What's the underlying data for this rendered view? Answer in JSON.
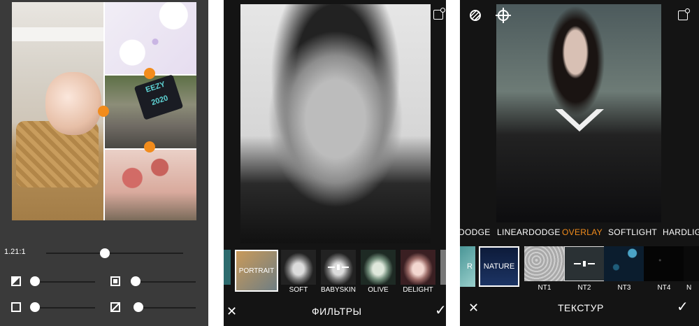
{
  "panel1": {
    "ratio_label": "1.21:1",
    "collage_sign_text": [
      "EEZY",
      "2020"
    ],
    "sliders": [
      {
        "icon": "border-icon",
        "level": 0.0
      },
      {
        "icon": "shadow-icon",
        "level": 0.0
      },
      {
        "icon": "frame-icon",
        "level": 0.0
      },
      {
        "icon": "corner-radius-icon",
        "level": 0.0
      }
    ],
    "ratio_slider_level": 0.42
  },
  "panel2": {
    "title": "ФИЛЬТРЫ",
    "filters": [
      {
        "label": "PORTRAIT"
      },
      {
        "label": "SOFT"
      },
      {
        "label": "BABYSKIN"
      },
      {
        "label": "OLIVE"
      },
      {
        "label": "DELIGHT"
      }
    ],
    "selected_filter": "PORTRAIT"
  },
  "panel3": {
    "title": "ТЕКСТУР",
    "blend_modes": [
      "DODGE",
      "LINEARDODGE",
      "OVERLAY",
      "SOFTLIGHT",
      "HARDLIGH"
    ],
    "active_blend": "OVERLAY",
    "textures": [
      {
        "label": "NATURE"
      },
      {
        "label": "NT1"
      },
      {
        "label": "NT2"
      },
      {
        "label": "NT3"
      },
      {
        "label": "NT4"
      },
      {
        "label": "N"
      }
    ],
    "partial_texture_text": "R"
  },
  "colors": {
    "accent": "#f28c1c",
    "toolbar_bg": "#141414",
    "panel1_bg": "#3a3a3a"
  }
}
